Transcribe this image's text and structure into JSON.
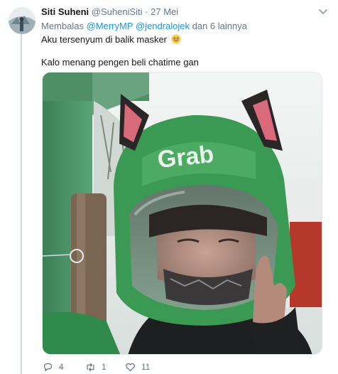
{
  "tweet": {
    "author_name": "Siti Suheni",
    "author_handle": "@SuheniSiti",
    "separator": "·",
    "date": "27 Mei",
    "reply_prefix": "Membalas",
    "reply_mention_1": "@MerryMP",
    "reply_mention_2": "@jendralojek",
    "reply_suffix": "dan 6 lainnya",
    "text_line_1": "Aku tersenyum di balik masker",
    "text_line_2": "Kalo menang pengen beli chatime gan",
    "emoji": "grinning-squinting-face",
    "image_logo_text": "Grab"
  },
  "actions": {
    "reply_count": "4",
    "retweet_count": "1",
    "like_count": "11"
  },
  "icons": {
    "more": "chevron-down-icon",
    "reply": "reply-icon",
    "retweet": "retweet-icon",
    "like": "heart-icon"
  },
  "colors": {
    "link": "#1b95e0",
    "muted": "#657786",
    "text": "#14171a",
    "grab_green": "#3a9a54"
  }
}
